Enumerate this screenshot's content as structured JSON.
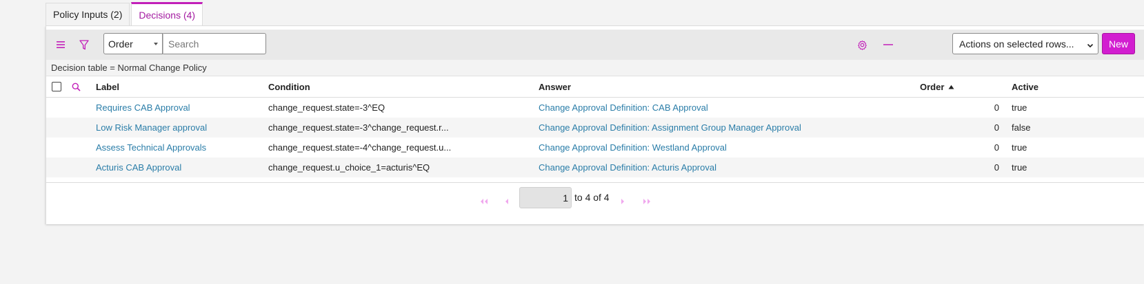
{
  "tabs": [
    {
      "label": "Policy Inputs (2)"
    },
    {
      "label": "Decisions (4)"
    }
  ],
  "toolbar": {
    "group_by_select": "Order",
    "search_placeholder": "Search",
    "actions_select": "Actions on selected rows...",
    "new_label": "New"
  },
  "breadcrumb": "Decision table = Normal Change Policy",
  "columns": {
    "label": "Label",
    "condition": "Condition",
    "answer": "Answer",
    "order": "Order",
    "active": "Active"
  },
  "rows": [
    {
      "label": "Requires CAB Approval",
      "condition": "change_request.state=-3^EQ",
      "answer": "Change Approval Definition: CAB Approval",
      "order": "0",
      "active": "true"
    },
    {
      "label": "Low Risk Manager approval",
      "condition": "change_request.state=-3^change_request.r...",
      "answer": "Change Approval Definition: Assignment Group Manager Approval",
      "order": "0",
      "active": "false"
    },
    {
      "label": "Assess Technical Approvals",
      "condition": "change_request.state=-4^change_request.u...",
      "answer": "Change Approval Definition: Westland Approval",
      "order": "0",
      "active": "true"
    },
    {
      "label": "Acturis CAB Approval",
      "condition": "change_request.u_choice_1=acturis^EQ",
      "answer": "Change Approval Definition: Acturis Approval",
      "order": "0",
      "active": "true"
    }
  ],
  "pagination": {
    "page_value": "1",
    "to_label": "to 4 of 4"
  },
  "colors": {
    "accent": "#c21fb9",
    "link": "#2a7da8",
    "new_button": "#d21ed0"
  }
}
